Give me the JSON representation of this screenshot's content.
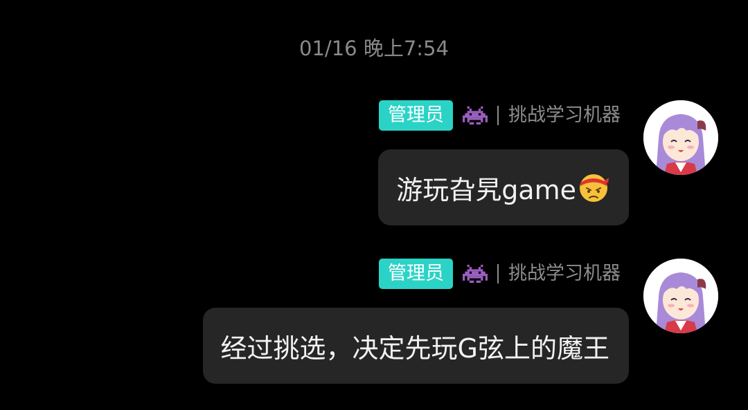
{
  "chat": {
    "timestamp": "01/16 晚上7:54",
    "messages": [
      {
        "role_badge": "管理员",
        "badge_icon": "alien-monster-icon",
        "nickname": "挑战学习机器",
        "text": "游玩旮旯game",
        "trailing_emoji": "angry-face-with-headband-icon"
      },
      {
        "role_badge": "管理员",
        "badge_icon": "alien-monster-icon",
        "nickname": "挑战学习机器",
        "text": "经过挑选，决定先玩G弦上的魔王"
      }
    ]
  },
  "colors": {
    "background": "#000000",
    "bubble": "#262626",
    "badge": "#2ad3c6",
    "meta_text": "#8d8d8d",
    "invader": "#9b5fc0"
  }
}
